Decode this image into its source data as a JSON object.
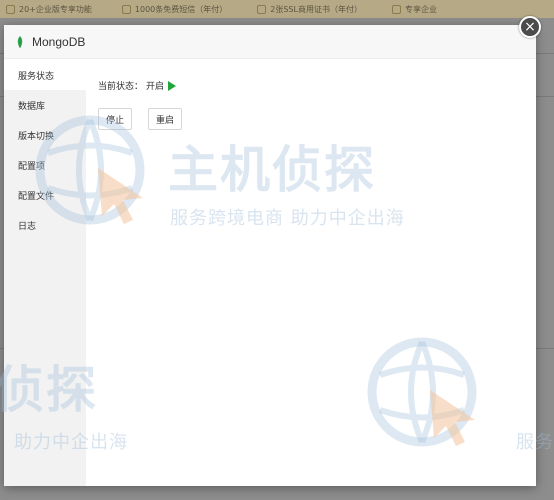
{
  "background": {
    "topbar_items": [
      {
        "label": "20+企业版专享功能"
      },
      {
        "label": "1000条免费短信（年付）"
      },
      {
        "label": "2张SSL商用证书（年付）"
      },
      {
        "label": "专享企业"
      }
    ]
  },
  "modal": {
    "title": "MongoDB",
    "close_label": "×",
    "sidebar": {
      "items": [
        {
          "label": "服务状态",
          "active": true
        },
        {
          "label": "数据库",
          "active": false
        },
        {
          "label": "版本切换",
          "active": false
        },
        {
          "label": "配置项",
          "active": false
        },
        {
          "label": "配置文件",
          "active": false
        },
        {
          "label": "日志",
          "active": false
        }
      ]
    },
    "status": {
      "label": "当前状态：",
      "value": "开启"
    },
    "buttons": {
      "stop": "停止",
      "restart": "重启"
    }
  },
  "watermark": {
    "brand": "主机侦探",
    "slogan": "服务跨境电商 助力中企出海",
    "brand_partial": "侦探",
    "slogan_partial": "助力中企出海",
    "slogan_edge": "服务"
  },
  "colors": {
    "accent_green": "#20a53a",
    "leaf_green": "#2fa84f",
    "close_bg": "#4b4b4b"
  }
}
